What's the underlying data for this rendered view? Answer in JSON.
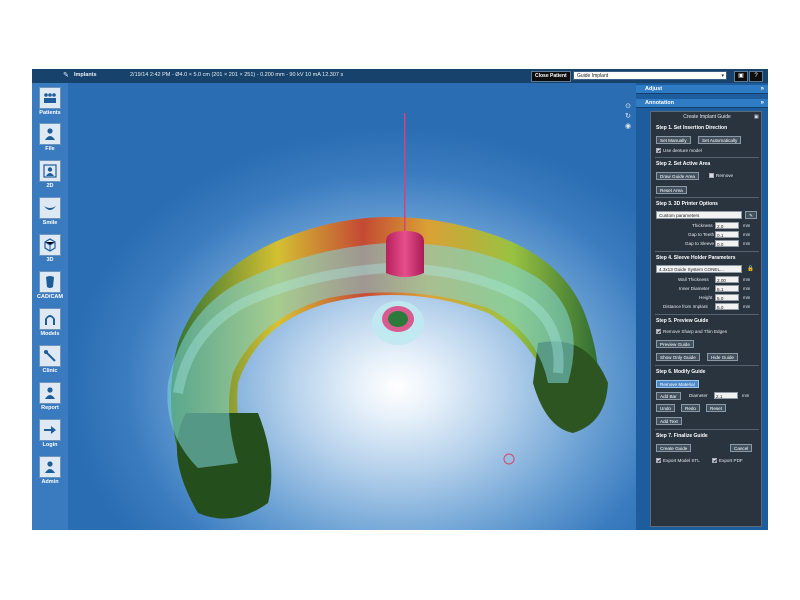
{
  "topbar": {
    "title": "Implants",
    "meta": "2/19/14 2:42 PM - Ø4.0 × 5.0 cm (201 × 201 × 251) - 0.200 mm - 90 kV 10 mA 12.307 s",
    "close_patient": "Close Patient",
    "guide_select": "Guide Implant"
  },
  "sidebar": {
    "items": [
      {
        "label": "Patients",
        "icon": "patients-icon"
      },
      {
        "label": "File",
        "icon": "file-icon"
      },
      {
        "label": "2D",
        "icon": "2d-icon"
      },
      {
        "label": "Smile",
        "icon": "smile-icon"
      },
      {
        "label": "3D",
        "icon": "3d-icon"
      },
      {
        "label": "CAD/CAM",
        "icon": "cad-cam-icon"
      },
      {
        "label": "Models",
        "icon": "models-icon"
      },
      {
        "label": "Clinic",
        "icon": "clinic-icon"
      },
      {
        "label": "Report",
        "icon": "report-icon"
      },
      {
        "label": "Login",
        "icon": "login-icon"
      },
      {
        "label": "Admin",
        "icon": "admin-icon"
      }
    ]
  },
  "panel": {
    "adjust": "Adjust",
    "annotation": "Annotation",
    "guide_title": "Create Implant Guide",
    "step1": "Step 1. Set Insertion Direction",
    "set_manually": "Set Manually",
    "set_automatically": "Set Automatically",
    "use_denture": "Use denture model",
    "step2": "Step 2. Set Active Area",
    "draw_guide_area": "Draw Guide Area",
    "remove": "Remove",
    "reset_area": "Reset Area",
    "step3": "Step 3. 3D Printer Options",
    "custom_parameters": "Custom parameters",
    "thickness_label": "Thickness",
    "thickness_value": "2.0",
    "gap_teeth_label": "Gap to Teeth",
    "gap_teeth_value": "0.1",
    "gap_sleeve_label": "Gap to Sleeve",
    "gap_sleeve_value": "0.0",
    "step4": "Step 4. Sleeve Holder Parameters",
    "sleeve_system": "4.3x13 Guide System CONEL...",
    "wall_label": "Wall Thickness",
    "wall_value": "2.00",
    "inner_label": "Inner Diameter",
    "inner_value": "5.1",
    "height_label": "Height",
    "height_value": "5.0",
    "distance_label": "Distance from Implant",
    "distance_value": "5.0",
    "unit": "mm",
    "step5": "Step 5. Preview Guide",
    "remove_sharp": "Remove Sharp and Thin Edges",
    "preview_guide": "Preview Guide",
    "show_only_guide": "Show Only Guide",
    "hide_guide": "Hide Guide",
    "step6": "Step 6. Modify Guide",
    "remove_material": "Remove Material",
    "add_bar": "Add Bar",
    "diameter_label": "Diameter",
    "diameter_value": "2.1",
    "undo": "Undo",
    "redo": "Redo",
    "reset": "Reset",
    "add_text": "Add Text",
    "step7": "Step 7. Finalize Guide",
    "create_guide": "Create Guide",
    "cancel": "Cancel",
    "export_model_stl": "Export Model STL",
    "export_pdf": "Export PDF"
  }
}
